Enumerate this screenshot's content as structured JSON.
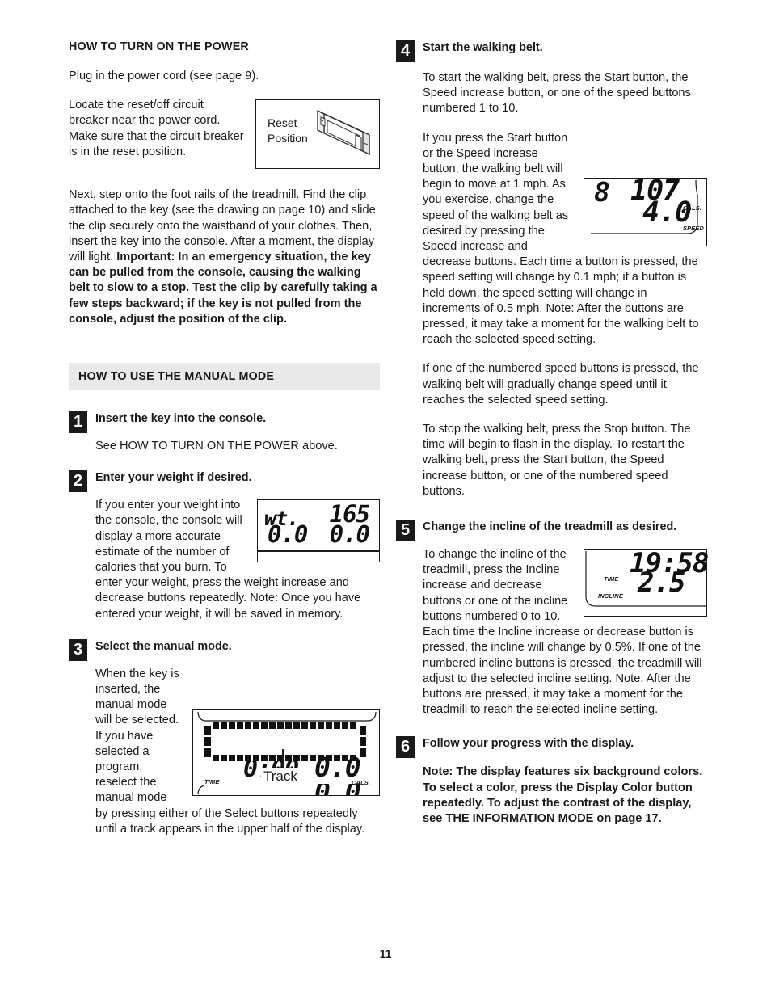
{
  "page": {
    "number": "11"
  },
  "left": {
    "heading": "HOW TO TURN ON THE POWER",
    "para_plug": "Plug in the power cord (see page 9).",
    "para_breaker": "Locate the reset/off circuit breaker near the power cord. Make sure that the circuit breaker is in the reset position.",
    "reset_figure": {
      "label_line1": "Reset",
      "label_line2": "Position",
      "icon": "circuit-breaker-switch-drawing"
    },
    "para_next_normal": "Next, step onto the foot rails of the treadmill. Find the clip attached to the key (see the drawing on page 10) and slide the clip securely onto the waistband of your clothes. Then, insert the key into the console. After a moment, the display will light. ",
    "para_next_bold": "Important: In an emergency situation, the key can be pulled from the console, causing the walking belt to slow to a stop. Test the clip by carefully taking a few steps backward; if the key is not pulled from the console, adjust the position of the clip.",
    "band": "HOW TO USE THE MANUAL MODE",
    "steps": [
      {
        "number": "1",
        "title": "Insert the key into the console.",
        "body": [
          "See HOW TO TURN ON THE POWER above."
        ]
      },
      {
        "number": "2",
        "title": "Enter your weight if desired.",
        "body": [
          "If you enter your weight into the console, the console will display a more accurate estimate of the number of calories that you burn. To enter your weight, press the weight increase and decrease buttons repeatedly. Note: Once you have entered your weight, it will be saved in memory."
        ],
        "figure": {
          "name": "weight-lcd",
          "label_wt": "wt.",
          "value_weight": "165",
          "value_left_lower": "0.0",
          "value_right_lower": "0.0"
        }
      },
      {
        "number": "3",
        "title": "Select the manual mode.",
        "body": [
          "When the key is inserted, the manual mode will be selected. If you have selected a program, reselect the manual mode by pressing either of the Select buttons repeatedly until a track appears in the upper half of the display."
        ],
        "figure": {
          "name": "track-lcd",
          "label_time": "TIME",
          "callout_track": "Track",
          "value_time": "0:00",
          "value_cals": "0.0",
          "label_cals": "CALS."
        }
      }
    ]
  },
  "right": {
    "steps": [
      {
        "number": "4",
        "title": "Start the walking belt.",
        "body": [
          "To start the walking belt, press the Start button, the Speed increase button, or one of the speed buttons numbered 1 to 10.",
          "If you press the Start button or the Speed increase button, the walking belt will begin to move at 1 mph. As you exercise, change the speed of the walking belt as desired by pressing the Speed increase and decrease buttons. Each time a button is pressed, the speed setting will change by 0.1 mph; if a button is held down, the speed setting will change in increments of 0.5 mph. Note: After the buttons are pressed, it may take a moment for the walking belt to reach the selected speed setting.",
          "If one of the numbered speed buttons is pressed, the walking belt will gradually change speed until it reaches the selected speed setting.",
          "To stop the walking belt, press the Stop button. The time will begin to flash in the display. To restart the walking belt, press the Start button, the Speed increase button, or one of the numbered speed buttons."
        ],
        "figure": {
          "name": "speed-lcd",
          "value_track": "8",
          "value_cals": "107",
          "label_cals": "CALS.",
          "value_speed": "4.0",
          "label_speed": "SPEED"
        }
      },
      {
        "number": "5",
        "title": "Change the incline of the treadmill as desired.",
        "body": [
          "To change the incline of the treadmill, press the Incline increase and decrease buttons or one of the incline buttons numbered 0 to 10. Each time the Incline increase or decrease button is pressed, the incline will change by 0.5%. If one of the numbered incline buttons is pressed, the treadmill will adjust to the selected incline setting. Note: After the buttons are pressed, it may take a moment for the treadmill to reach the selected incline setting."
        ],
        "figure": {
          "name": "incline-lcd",
          "label_time": "TIME",
          "value_time": "19:58",
          "label_incline": "INCLINE",
          "value_incline": "2.5"
        }
      },
      {
        "number": "6",
        "title": "Follow your progress with the display.",
        "body_bold": "Note: The display features six background colors. To select a color, press the Display Color button repeatedly. To adjust the contrast of the display, see THE INFORMATION MODE on page 17."
      }
    ]
  }
}
